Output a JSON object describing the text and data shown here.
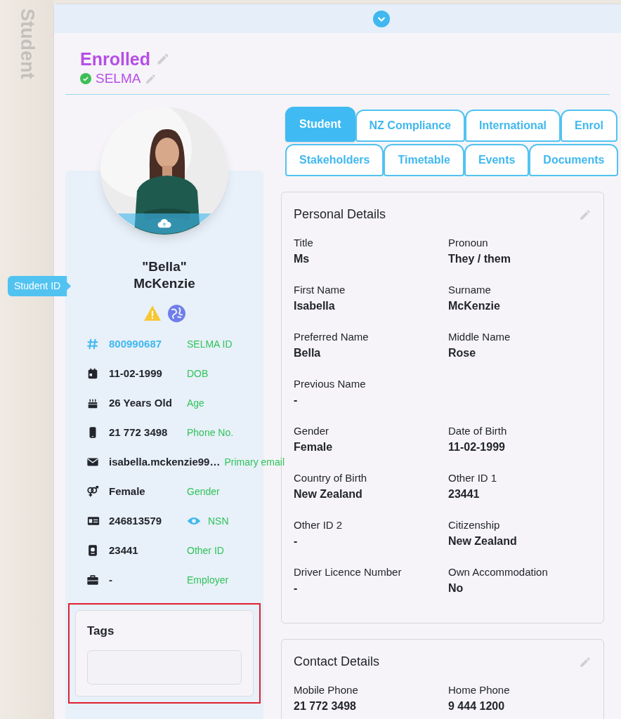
{
  "side_tab": {
    "label": "Student"
  },
  "header": {
    "status": "Enrolled",
    "selma": {
      "label": "SELMA",
      "verified": true
    }
  },
  "profile": {
    "nickname": "\"Bella\"",
    "surname": "McKenzie",
    "tooltip": "Student ID",
    "facts": [
      {
        "kind": "hash",
        "value": "800990687",
        "label": "SELMA ID",
        "highlight": true
      },
      {
        "kind": "calendar",
        "value": "11-02-1999",
        "label": "DOB",
        "highlight": false
      },
      {
        "kind": "cake",
        "value": "26 Years Old",
        "label": "Age",
        "highlight": false
      },
      {
        "kind": "phone",
        "value": "21 772 3498",
        "label": "Phone No.",
        "highlight": false
      },
      {
        "kind": "mail",
        "value": "isabella.mckenzie99…",
        "label": "Primary email",
        "highlight": false
      },
      {
        "kind": "gender",
        "value": "Female",
        "label": "Gender",
        "highlight": false
      },
      {
        "kind": "idcard",
        "value": "246813579",
        "label": "NSN",
        "highlight": false,
        "reveal": true
      },
      {
        "kind": "passport",
        "value": "23441",
        "label": "Other ID",
        "highlight": false
      },
      {
        "kind": "briefcase",
        "value": "-",
        "label": "Employer",
        "highlight": false
      }
    ],
    "tags": {
      "title": "Tags"
    }
  },
  "tabs": [
    [
      {
        "label": "Student",
        "selected": true
      },
      {
        "label": "NZ Compliance",
        "selected": false
      },
      {
        "label": "International",
        "selected": false
      },
      {
        "label": "Enrol",
        "selected": false
      }
    ],
    [
      {
        "label": "Stakeholders",
        "selected": false
      },
      {
        "label": "Timetable",
        "selected": false
      },
      {
        "label": "Events",
        "selected": false
      },
      {
        "label": "Documents",
        "selected": false
      }
    ]
  ],
  "cards": [
    {
      "title": "Personal Details",
      "rows": [
        [
          {
            "label": "Title",
            "value": "Ms"
          },
          {
            "label": "Pronoun",
            "value": "They / them"
          }
        ],
        [
          {
            "label": "First Name",
            "value": "Isabella"
          },
          {
            "label": "Surname",
            "value": "McKenzie"
          }
        ],
        [
          {
            "label": "Preferred Name",
            "value": "Bella"
          },
          {
            "label": "Middle Name",
            "value": "Rose"
          }
        ],
        [
          {
            "label": "Previous Name",
            "value": "-"
          }
        ],
        [
          {
            "label": "Gender",
            "value": "Female"
          },
          {
            "label": "Date of Birth",
            "value": "11-02-1999"
          }
        ],
        [
          {
            "label": "Country of Birth",
            "value": "New Zealand"
          },
          {
            "label": "Other ID 1",
            "value": "23441"
          }
        ],
        [
          {
            "label": "Other ID 2",
            "value": "-"
          },
          {
            "label": "Citizenship",
            "value": "New Zealand"
          }
        ],
        [
          {
            "label": "Driver Licence Number",
            "value": "-"
          },
          {
            "label": "Own Accommodation",
            "value": "No"
          }
        ]
      ]
    },
    {
      "title": "Contact Details",
      "rows": [
        [
          {
            "label": "Mobile Phone",
            "value": "21 772 3498"
          },
          {
            "label": "Home Phone",
            "value": "9 444 1200"
          }
        ]
      ]
    }
  ]
}
